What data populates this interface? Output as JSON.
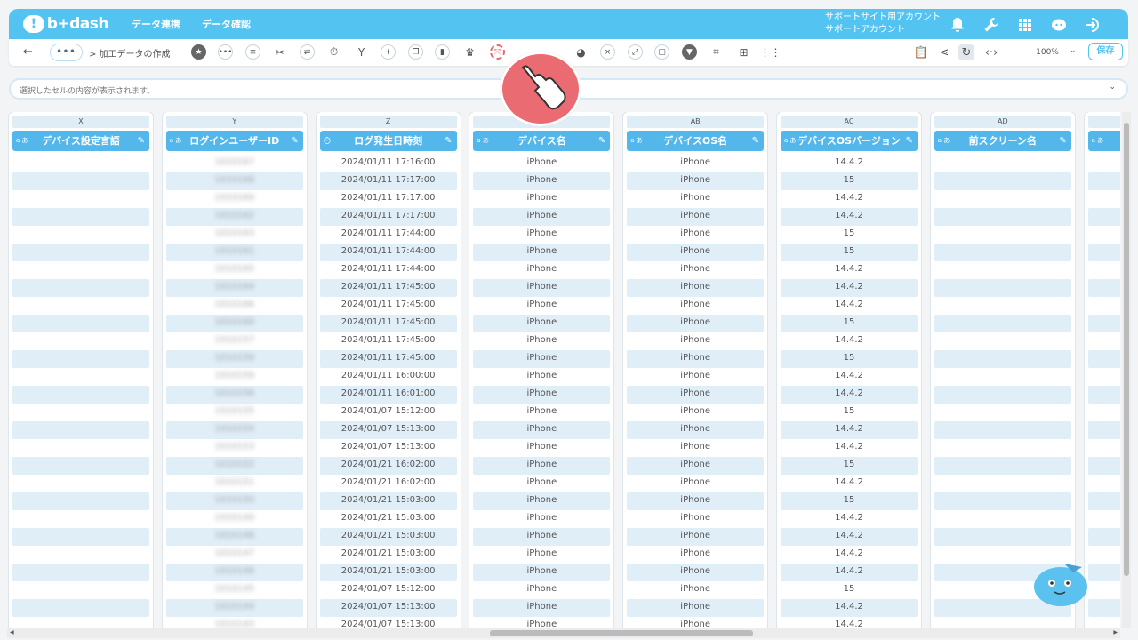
{
  "header": {
    "logo": "b+dash",
    "nav": [
      "データ連携",
      "データ確認"
    ],
    "account_line1": "サポートサイト用アカウント",
    "account_line2": "サポートアカウント",
    "icons": [
      "bell-icon",
      "wrench-icon",
      "grid-icon",
      "support-icon",
      "logout-icon"
    ]
  },
  "toolbar": {
    "back": "←",
    "more": "•••",
    "breadcrumb": "> 加工データの作成",
    "zoom": "100%",
    "save": "保存"
  },
  "cell_bar": {
    "placeholder": "選択したセルの内容が表示されます。"
  },
  "columns": [
    {
      "letter": "X",
      "name": "デバイス設定言語",
      "type": "a-text",
      "values": []
    },
    {
      "letter": "Y",
      "name": "ログインユーザーID",
      "type": "a-text",
      "values": [
        "1010167",
        "1010168",
        "1010169",
        "1010162",
        "1010163",
        "1010161",
        "1010165",
        "1010164",
        "1010166",
        "1010160",
        "1010157",
        "1010158",
        "1010159",
        "1010156",
        "1010155",
        "1010154",
        "1010153",
        "1010152",
        "1010151",
        "1010150",
        "1010149",
        "1010148",
        "1010147",
        "1010146",
        "1010145",
        "1010144",
        "1010143"
      ]
    },
    {
      "letter": "Z",
      "name": "ログ発生日時刻",
      "type": "clock",
      "values": [
        "2024/01/11 17:16:00",
        "2024/01/11 17:17:00",
        "2024/01/11 17:17:00",
        "2024/01/11 17:17:00",
        "2024/01/11 17:44:00",
        "2024/01/11 17:44:00",
        "2024/01/11 17:44:00",
        "2024/01/11 17:45:00",
        "2024/01/11 17:45:00",
        "2024/01/11 17:45:00",
        "2024/01/11 17:45:00",
        "2024/01/11 17:45:00",
        "2024/01/11 16:00:00",
        "2024/01/11 16:01:00",
        "2024/01/07 15:12:00",
        "2024/01/07 15:13:00",
        "2024/01/07 15:13:00",
        "2024/01/21 16:02:00",
        "2024/01/21 16:02:00",
        "2024/01/21 15:03:00",
        "2024/01/21 15:03:00",
        "2024/01/21 15:03:00",
        "2024/01/21 15:03:00",
        "2024/01/21 15:03:00",
        "2024/01/07 15:12:00",
        "2024/01/07 15:13:00",
        "2024/01/07 15:13:00"
      ]
    },
    {
      "letter": "AA",
      "name": "デバイス名",
      "type": "a-text",
      "values": [
        "iPhone",
        "iPhone",
        "iPhone",
        "iPhone",
        "iPhone",
        "iPhone",
        "iPhone",
        "iPhone",
        "iPhone",
        "iPhone",
        "iPhone",
        "iPhone",
        "iPhone",
        "iPhone",
        "iPhone",
        "iPhone",
        "iPhone",
        "iPhone",
        "iPhone",
        "iPhone",
        "iPhone",
        "iPhone",
        "iPhone",
        "iPhone",
        "iPhone",
        "iPhone",
        "iPhone"
      ]
    },
    {
      "letter": "AB",
      "name": "デバイスOS名",
      "type": "a-text",
      "values": [
        "iPhone",
        "iPhone",
        "iPhone",
        "iPhone",
        "iPhone",
        "iPhone",
        "iPhone",
        "iPhone",
        "iPhone",
        "iPhone",
        "iPhone",
        "iPhone",
        "iPhone",
        "iPhone",
        "iPhone",
        "iPhone",
        "iPhone",
        "iPhone",
        "iPhone",
        "iPhone",
        "iPhone",
        "iPhone",
        "iPhone",
        "iPhone",
        "iPhone",
        "iPhone",
        "iPhone"
      ]
    },
    {
      "letter": "AC",
      "name": "デバイスOSバージョン",
      "type": "a-text",
      "values": [
        "14.4.2",
        "15",
        "14.4.2",
        "14.4.2",
        "15",
        "15",
        "14.4.2",
        "14.4.2",
        "14.4.2",
        "15",
        "14.4.2",
        "15",
        "14.4.2",
        "14.4.2",
        "15",
        "14.4.2",
        "14.4.2",
        "15",
        "14.4.2",
        "15",
        "14.4.2",
        "14.4.2",
        "14.4.2",
        "14.4.2",
        "15",
        "14.4.2",
        "14.4.2"
      ]
    },
    {
      "letter": "AD",
      "name": "前スクリーン名",
      "type": "a-text",
      "values": []
    },
    {
      "letter": "",
      "name": "",
      "type": "a-text",
      "values": []
    }
  ]
}
